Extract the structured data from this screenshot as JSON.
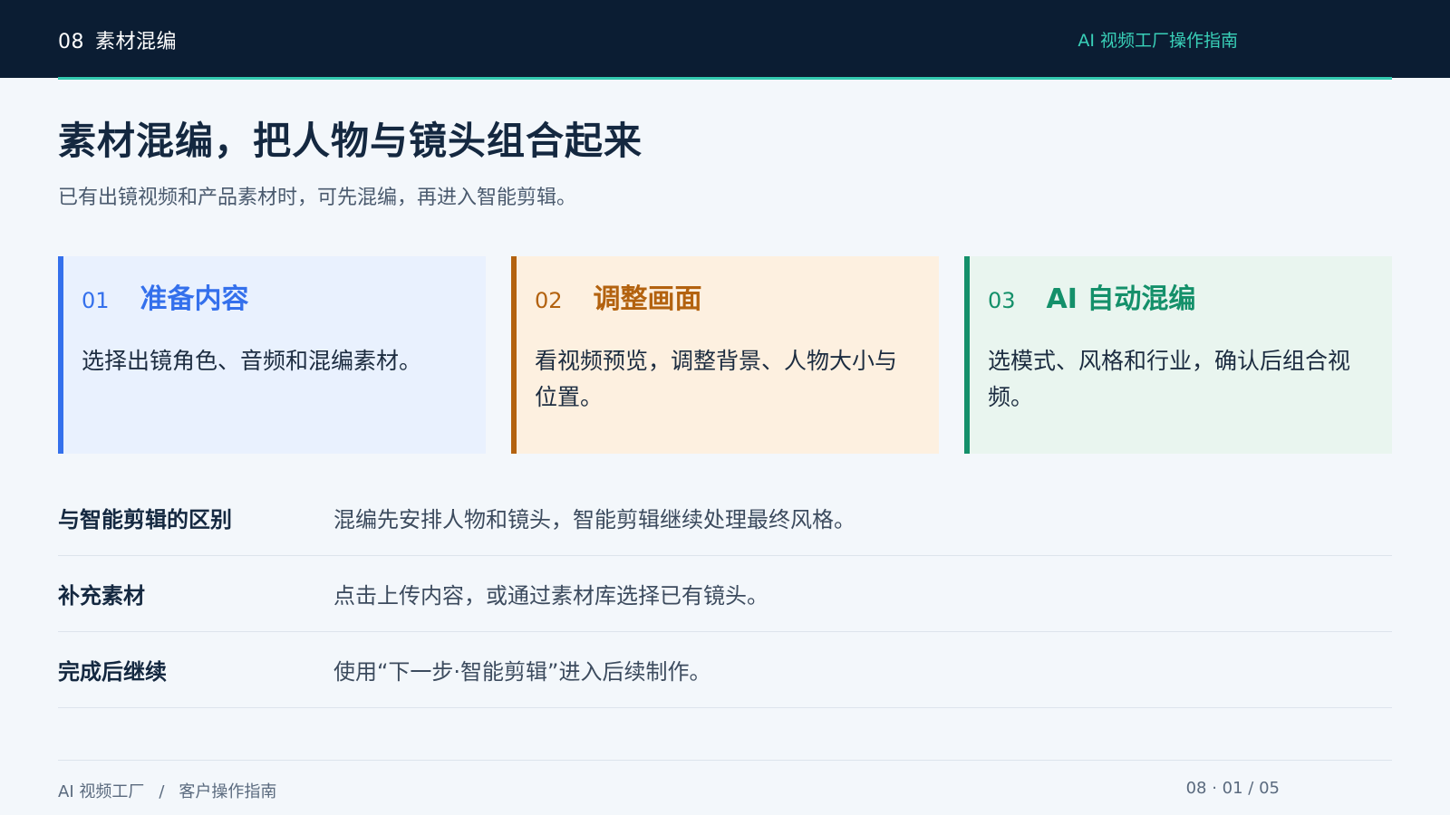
{
  "header": {
    "section_number": "08",
    "section_name": "素材混编",
    "guide_title": "AI 视频工厂操作指南",
    "accent_color": "#33c9b0",
    "background_color": "#0b1d33"
  },
  "main": {
    "title": "素材混编，把人物与镜头组合起来",
    "subtitle": "已有出镜视频和产品素材时，可先混编，再进入智能剪辑。"
  },
  "steps": [
    {
      "number": "01",
      "title": "准备内容",
      "description": "选择出镜角色、音频和混编素材。",
      "color": "#3470ec"
    },
    {
      "number": "02",
      "title": "调整画面",
      "description": "看视频预览，调整背景、人物大小与位置。",
      "color": "#b3620f"
    },
    {
      "number": "03",
      "title": "AI 自动混编",
      "description": "选模式、风格和行业，确认后组合视频。",
      "color": "#14906a"
    }
  ],
  "details": [
    {
      "label": "与智能剪辑的区别",
      "value": "混编先安排人物和镜头，智能剪辑继续处理最终风格。"
    },
    {
      "label": "补充素材",
      "value": "点击上传内容，或通过素材库选择已有镜头。"
    },
    {
      "label": "完成后继续",
      "value": "使用“下一步·智能剪辑”进入后续制作。"
    }
  ],
  "footer": {
    "product": "AI 视频工厂",
    "separator": "/",
    "doc": "客户操作指南",
    "page_indicator": "08 · 01 / 05"
  }
}
